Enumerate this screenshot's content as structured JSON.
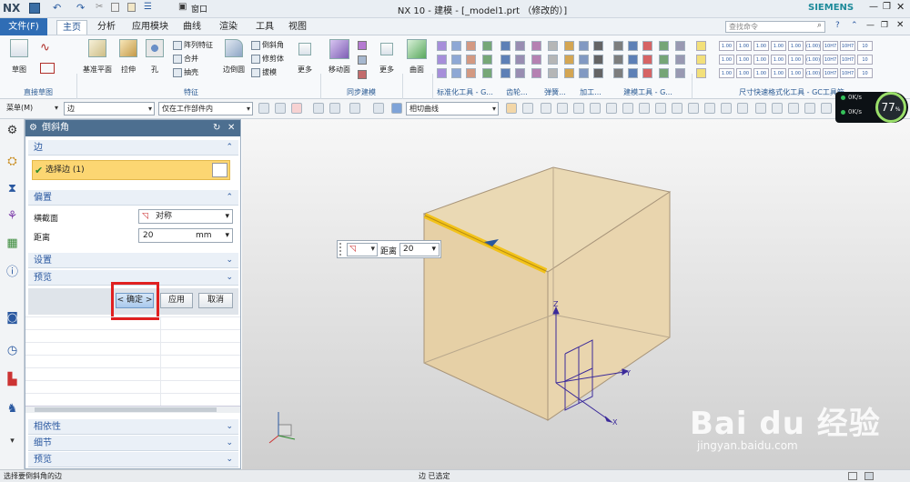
{
  "window": {
    "logo": "NX",
    "title": "NX 10 - 建模 - [_model1.prt （修改的）]",
    "brand": "SIEMENS",
    "window_menu": "窗口",
    "search_placeholder": "查找命令"
  },
  "ribbon_tabs": {
    "file": "文件(F)",
    "items": [
      "主页",
      "分析",
      "应用模块",
      "曲线",
      "渲染",
      "工具",
      "视图"
    ],
    "active": "主页"
  },
  "ribbon": {
    "sketch": "草图",
    "datum_plane": "基准平面",
    "extrude": "拉伸",
    "hole": "孔",
    "pattern_feature": "阵列特征",
    "unite": "合并",
    "shell": "抽壳",
    "edge_blend": "边倒圆",
    "chamfer": "倒斜角",
    "trim_body": "修剪体",
    "draft": "拔模",
    "more": "更多",
    "move_face": "移动面",
    "surface": "曲面",
    "groups": [
      "直接草图",
      "特征",
      "同步建模",
      "标准化工具 - G...",
      "齿轮...",
      "弹簧...",
      "加工...",
      "建模工具 - G...",
      "尺寸快速格式化工具 - GC工具箱"
    ]
  },
  "selection_bar": {
    "menu": "菜单(M)",
    "filter": "边",
    "scope": "仅在工作部件内",
    "curve_rule": "相切曲线"
  },
  "dialog": {
    "title": "倒斜角",
    "section_edge": "边",
    "select_edge": "选择边 (1)",
    "section_offset": "偏置",
    "cross_section_label": "横截面",
    "cross_section_value": "对称",
    "distance_label": "距离",
    "distance_value": "20",
    "unit": "mm",
    "section_settings": "设置",
    "section_preview": "预览",
    "ok": "< 确定 >",
    "apply": "应用",
    "cancel": "取消",
    "bottom_sections": [
      "相依性",
      "细节",
      "预览"
    ]
  },
  "viewport": {
    "float_label": "距离",
    "float_value": "20",
    "axis_z": "Z",
    "axis_y": "Y",
    "axis_x": "X"
  },
  "network": {
    "up": "0K/s",
    "down": "0K/s",
    "percent": "77",
    "percent_sign": "%"
  },
  "watermark": {
    "brand": "Bai du 经验",
    "url": "jingyan.baidu.com"
  },
  "status": {
    "prompt": "选择要倒斜角的边",
    "info": "边 已选定"
  },
  "colors": {
    "accent": "#2f6db5",
    "dialog_title": "#4d6f90",
    "selection": "#fcd672",
    "highlight_box": "#e02020",
    "cube_face": "#e9d6b0",
    "edge_selected": "#f2c21a"
  }
}
